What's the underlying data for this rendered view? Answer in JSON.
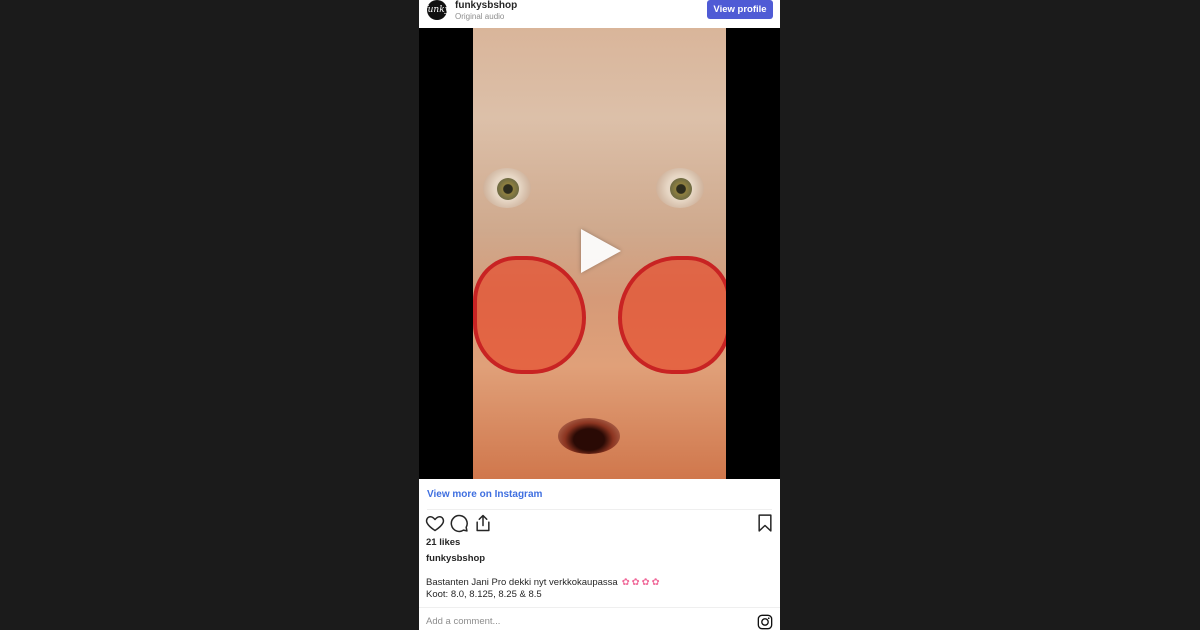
{
  "post": {
    "avatar_text": "funky",
    "username": "funkysbshop",
    "audio_label": "Original audio",
    "view_profile_label": "View profile",
    "view_more_label": "View more on Instagram",
    "likes_text": "21 likes",
    "caption_user": "funkysbshop",
    "caption_line1": "Bastanten Jani Pro dekki nyt verkkokaupassa",
    "caption_emojis": "✿✿✿✿",
    "caption_line2": "Koot: 8.0, 8.125, 8.25 & 8.5",
    "comment_placeholder": "Add a comment..."
  },
  "icons": {
    "like": "heart-icon",
    "comment": "comment-bubble-icon",
    "share": "share-icon",
    "save": "bookmark-icon",
    "play": "play-icon",
    "instagram": "instagram-logo-icon"
  },
  "colors": {
    "page_background": "#1b1b1b",
    "button_blue": "#4f5bd5",
    "link_blue": "#3f6fe0",
    "emoji_pink": "#f06a9a"
  }
}
